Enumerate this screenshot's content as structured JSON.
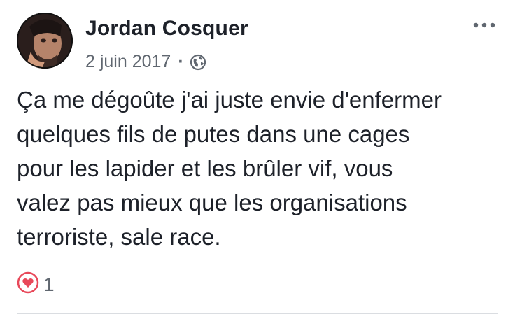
{
  "post": {
    "author_name": "Jordan Cosquer",
    "date": "2 juin 2017",
    "separator": "·",
    "audience_icon": "globe-icon",
    "more_icon": "more-options-icon",
    "text_lines": [
      "Ça me dégoûte j'ai juste envie d'enfermer",
      "quelques fils de putes dans une cages",
      "pour les lapider et les brûler vif, vous",
      "valez pas mieux que les organisations",
      "terroriste, sale race."
    ],
    "reaction_icon": "love-reaction-icon",
    "reaction_count": "1"
  },
  "colors": {
    "text_primary": "#1d2129",
    "text_secondary": "#606770",
    "love_red": "#e8495a",
    "divider": "#dadde1"
  }
}
